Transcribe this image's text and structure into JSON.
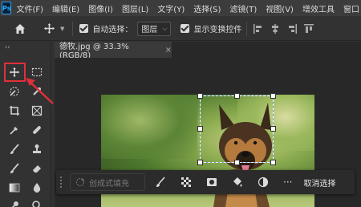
{
  "app": {
    "logo_text": "Ps"
  },
  "menu": {
    "items": [
      "文件(F)",
      "编辑(E)",
      "图像(I)",
      "图层(L)",
      "文字(Y)",
      "选择(S)",
      "滤镜(T)",
      "视图(V)",
      "增效工具",
      "窗口"
    ]
  },
  "options": {
    "auto_select_label": "自动选择：",
    "auto_select_value": "图层",
    "show_transform_label": "显示变换控件"
  },
  "document": {
    "tab_title": "德牧.jpg @ 33.3%(RGB/8)",
    "close_glyph": "×"
  },
  "toolbar": {
    "collapse_glyph": "‹‹"
  },
  "context_bar": {
    "generative_fill_label": "创成式填充",
    "more_glyph": "···",
    "cancel_selection_label": "取消选择"
  },
  "colors": {
    "highlight": "#e0303a",
    "selection_handle": "#ffffff",
    "bbox": "#5a8fd8",
    "ps_brand": "#31a8ff"
  }
}
